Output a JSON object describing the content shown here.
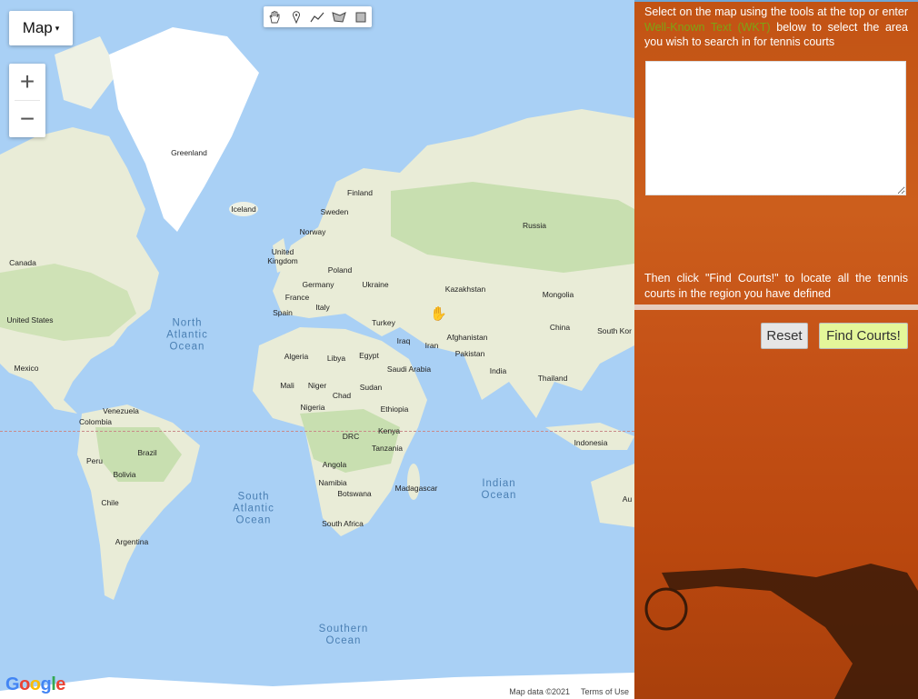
{
  "map": {
    "type_label": "Map",
    "zoom_in": "+",
    "zoom_out": "−",
    "drawing_tools": [
      "hand-icon",
      "marker-icon",
      "polyline-icon",
      "polygon-icon",
      "rectangle-icon"
    ],
    "google_logo": "Google",
    "map_data": "Map data ©2021",
    "terms": "Terms of Use",
    "labels": {
      "greenland": "Greenland",
      "iceland": "Iceland",
      "finland": "Finland",
      "sweden": "Sweden",
      "norway": "Norway",
      "russia": "Russia",
      "uk": "United\nKingdom",
      "canada": "Canada",
      "poland": "Poland",
      "germany": "Germany",
      "ukraine": "Ukraine",
      "kazakhstan": "Kazakhstan",
      "mongolia": "Mongolia",
      "france": "France",
      "italy": "Italy",
      "spain": "Spain",
      "turkey": "Turkey",
      "china": "China",
      "south_korea": "South Kor",
      "us": "United States",
      "iraq": "Iraq",
      "iran": "Iran",
      "afghanistan": "Afghanistan",
      "pakistan": "Pakistan",
      "algeria": "Algeria",
      "libya": "Libya",
      "egypt": "Egypt",
      "saudi": "Saudi Arabia",
      "india": "India",
      "thailand": "Thailand",
      "mexico": "Mexico",
      "mali": "Mali",
      "niger": "Niger",
      "chad": "Chad",
      "sudan": "Sudan",
      "nigeria": "Nigeria",
      "ethiopia": "Ethiopia",
      "venezuela": "Venezuela",
      "colombia": "Colombia",
      "kenya": "Kenya",
      "drc": "DRC",
      "tanzania": "Tanzania",
      "indonesia": "Indonesia",
      "peru": "Peru",
      "brazil": "Brazil",
      "bolivia": "Bolivia",
      "angola": "Angola",
      "namibia": "Namibia",
      "botswana": "Botswana",
      "madagascar": "Madagascar",
      "chile": "Chile",
      "south_africa": "South Africa",
      "argentina": "Argentina",
      "australia": "Au"
    },
    "oceans": {
      "north_atlantic": "North\nAtlantic\nOcean",
      "south_atlantic": "South\nAtlantic\nOcean",
      "indian": "Indian\nOcean",
      "southern": "Southern\nOcean"
    },
    "colors": {
      "water": "#a9d0f5",
      "land": "#f2efe6",
      "forest": "#c8dfb0",
      "ice": "#ffffff"
    }
  },
  "panel": {
    "instruction_1a": "Select on the map using the tools at the top or enter ",
    "instruction_wkt": "Well-Known Text (WKT)",
    "instruction_1b": " below to select the area you wish to search in for tennis courts",
    "wkt_value": "",
    "instruction_2": "Then click \"Find Courts!\" to locate all the tennis courts in the region you have defined",
    "reset_label": "Reset",
    "find_label": "Find Courts!",
    "colors": {
      "clay": "#c25314",
      "find_button": "#e4f79a",
      "link": "#7ea315"
    }
  }
}
